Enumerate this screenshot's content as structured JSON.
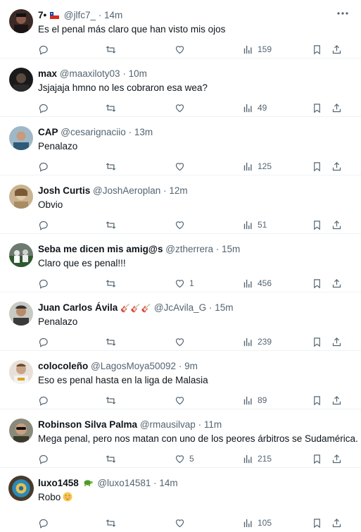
{
  "colors": {
    "text": "#0f1419",
    "secondary": "#536471",
    "divider": "#eff3f4"
  },
  "icons": {
    "reply": "reply-icon",
    "retweet": "retweet-icon",
    "like": "heart-icon",
    "views": "views-icon",
    "bookmark": "bookmark-icon",
    "share": "share-icon",
    "more": "more-icon"
  },
  "tweets": [
    {
      "name": "7•",
      "handle": "@jlfc7_",
      "dot": "·",
      "time": "14m",
      "text": "Es el penal más claro que han visto mis ojos",
      "replies": "",
      "retweets": "",
      "likes": "",
      "views": "159"
    },
    {
      "name": "max",
      "handle": "@maaxiloty03",
      "dot": "·",
      "time": "10m",
      "text": "Jsjajaja hmno no les cobraron esa wea?",
      "replies": "",
      "retweets": "",
      "likes": "",
      "views": "49"
    },
    {
      "name": "CAP",
      "handle": "@cesarignaciio",
      "dot": "·",
      "time": "13m",
      "text": "Penalazo",
      "replies": "",
      "retweets": "",
      "likes": "",
      "views": "125"
    },
    {
      "name": "Josh Curtis",
      "handle": "@JoshAeroplan",
      "dot": "·",
      "time": "12m",
      "text": "Obvio",
      "replies": "",
      "retweets": "",
      "likes": "",
      "views": "51"
    },
    {
      "name": "Seba me dicen mis amig@s",
      "handle": "@ztherrera",
      "dot": "·",
      "time": "15m",
      "text": "Claro que es penal!!!",
      "replies": "",
      "retweets": "",
      "likes": "1",
      "views": "456"
    },
    {
      "name": "Juan Carlos Ávila",
      "handle": "@JcAvila_G",
      "dot": "·",
      "time": "15m",
      "text": "Penalazo",
      "replies": "",
      "retweets": "",
      "likes": "",
      "views": "239"
    },
    {
      "name": "colocoleño",
      "handle": "@LagosMoya50092",
      "dot": "·",
      "time": "9m",
      "text": "Eso es penal hasta en la liga de Malasia",
      "replies": "",
      "retweets": "",
      "likes": "",
      "views": "89"
    },
    {
      "name": "Robinson Silva Palma",
      "handle": "@rmausilvap",
      "dot": "·",
      "time": "11m",
      "text": "Mega penal, pero nos matan con uno de los peores árbitros se Sudamérica.",
      "replies": "",
      "retweets": "",
      "likes": "5",
      "views": "215"
    },
    {
      "name": "luxo1458",
      "handle": "@luxo14581",
      "dot": "·",
      "time": "14m",
      "text": "Robo",
      "replies": "",
      "retweets": "",
      "likes": "",
      "views": "105"
    }
  ]
}
